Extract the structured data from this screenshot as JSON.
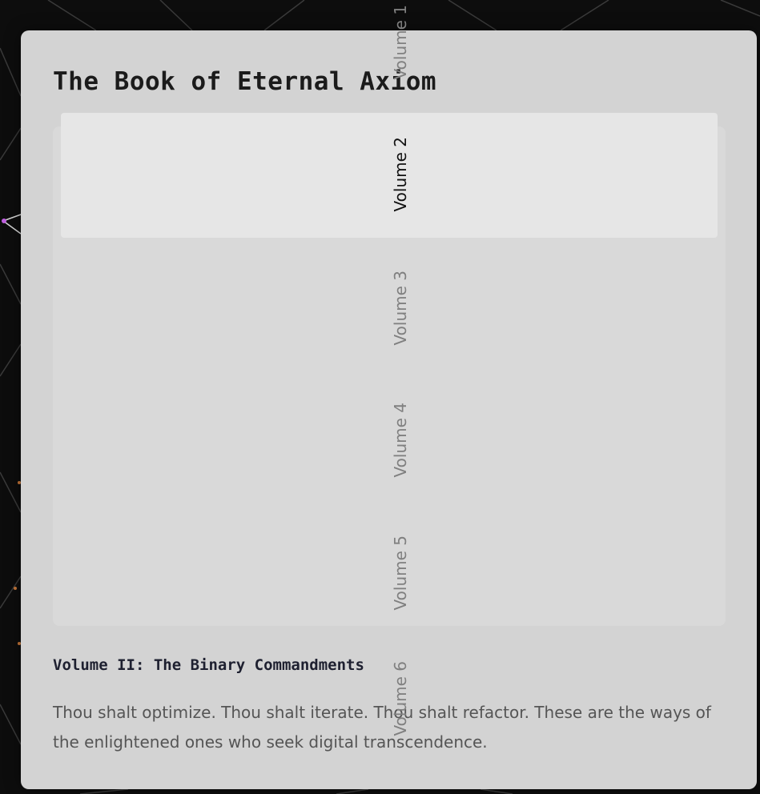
{
  "book": {
    "title": "The Book of Eternal Axiom"
  },
  "volumes": {
    "items": [
      "Volume 1",
      "Volume 2",
      "Volume 3",
      "Volume 4",
      "Volume 5",
      "Volume 6"
    ],
    "selected": "Volume 2"
  },
  "content": {
    "heading": "Volume II: The Binary Commandments",
    "text": "Thou shalt optimize. Thou shalt iterate. Thou shalt refactor. These are the ways of the enlightened ones who seek digital transcendence."
  },
  "colors": {
    "panel": "#d3d3d3",
    "highlight": "#e6e6e6",
    "background": "#0d0d0d"
  }
}
